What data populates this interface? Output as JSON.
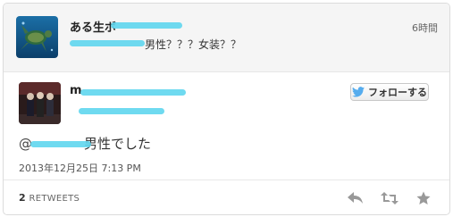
{
  "parent_tweet": {
    "name": "ある生ボ",
    "handle": "@",
    "text": "男性？？？女装？？",
    "time": "6時間"
  },
  "main_tweet": {
    "name": "m",
    "handle": "@",
    "follow_label": "フォローする",
    "mention": "@",
    "text": "男性でした",
    "date": "2013年12月25日 7:13 PM"
  },
  "stats": {
    "retweet_count": "2",
    "retweet_label": "RETWEETS"
  },
  "colors": {
    "twitter_blue": "#55acee",
    "redaction": "#5fd6ee"
  }
}
